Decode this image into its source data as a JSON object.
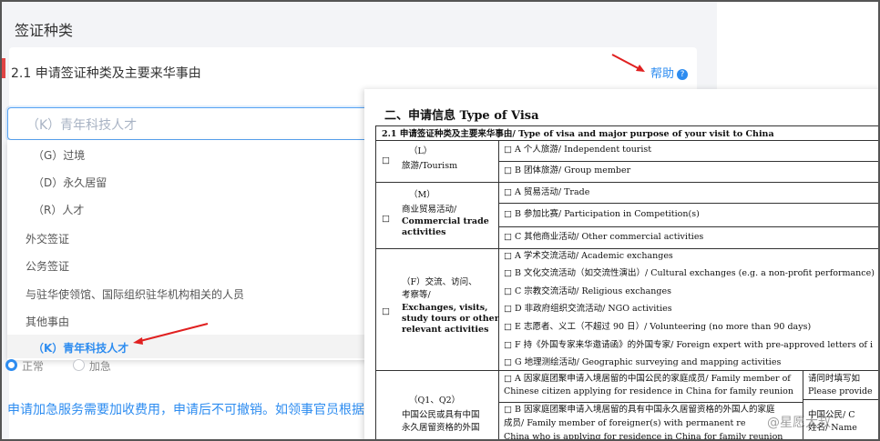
{
  "section_title": "签证种类",
  "question": {
    "label": "2.1 申请签证种类及主要来华事由",
    "help_label": "帮助",
    "help_icon": "question-icon"
  },
  "select": {
    "placeholder": "（K）青年科技人才"
  },
  "options": [
    {
      "label": "（G）过境",
      "level": "sub"
    },
    {
      "label": "（D）永久居留",
      "level": "sub"
    },
    {
      "label": "（R）人才",
      "level": "sub"
    },
    {
      "label": "外交签证",
      "level": "top"
    },
    {
      "label": "公务签证",
      "level": "top"
    },
    {
      "label": "与驻华使领馆、国际组织驻华机构相关的人员",
      "level": "top"
    },
    {
      "label": "其他事由",
      "level": "top"
    },
    {
      "label": "（K）青年科技人才",
      "level": "sub",
      "selected": true
    }
  ],
  "service": {
    "normal": "正常",
    "urgent": "加急"
  },
  "notice": "申请加急服务需要加收费用，申请后不可撤销。如领事官员根据",
  "doc": {
    "title": "二、申请信息  Type of Visa",
    "row_header": "2.1  申请签证种类及主要来华事由/ Type of visa and major purpose of your visit to China",
    "checkbox": "□",
    "L": {
      "cat": "（L）",
      "cat2": "旅游/Tourism",
      "items": [
        "□ A 个人旅游/ Independent tourist",
        "□ B 团体旅游/ Group member"
      ]
    },
    "M": {
      "cat": "（M）",
      "cat2": "商业贸易活动/",
      "cat3": "Commercial trade",
      "cat4": "activities",
      "items": [
        "□ A 贸易活动/ Trade",
        "□ B 参加比赛/ Participation in Competition(s)",
        "□ C 其他商业活动/ Other commercial activities"
      ]
    },
    "F": {
      "cat": "（F）交流、访问、",
      "cat2": "考察等/",
      "cat3": "Exchanges, visits,",
      "cat4": "study tours or other",
      "cat5": "relevant activities",
      "items": [
        "□ A 学术交流活动/ Academic exchanges",
        "□ B 文化交流活动（如交流性演出）/ Cultural exchanges (e.g. a non-profit performance)",
        "□ C 宗教交流活动/ Religious exchanges",
        "□ D 非政府组织交流活动/ NGO activities",
        "□ E 志愿者、义工（不超过 90 日）/ Volunteering (no more than 90 days)",
        "□ F 持《外国专家来华邀请函》的外国专家/    Foreign expert with pre-approved letters of i",
        "□ G 地理测绘活动/ Geographic surveying and mapping activities"
      ]
    },
    "Q": {
      "cat": "（Q1、Q2）",
      "cat2": "中国公民或具有中国",
      "cat3": "永久居留资格的外国",
      "a1": "□ A 因家庭团聚申请入境居留的中国公民的家庭成员/ Family member of",
      "a2": "Chinese citizen applying for residence in China for family reunion",
      "b1": "□ B 因家庭团聚申请入境居留的具有中国永久居留资格的外国人的家庭",
      "b2": "成员/ Family member of foreigner(s) with permanent re",
      "b3": "China who is applying for residence in China for family reunion",
      "side1": "请同时填写如",
      "side2": "Please provide",
      "side3": "中国公民/ C",
      "side4": "姓名/ Name"
    }
  },
  "watermark": "@星愿大叔"
}
